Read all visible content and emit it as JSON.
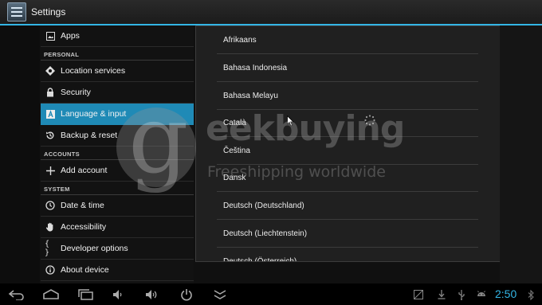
{
  "app": {
    "title": "Settings",
    "accent_color": "#33b5e5",
    "selected_color": "#1f8ab6"
  },
  "sidebar": {
    "items": [
      {
        "type": "item",
        "label": "Apps",
        "icon": "apps-icon"
      },
      {
        "type": "header",
        "label": "PERSONAL"
      },
      {
        "type": "item",
        "label": "Location services",
        "icon": "location-icon"
      },
      {
        "type": "item",
        "label": "Security",
        "icon": "lock-icon"
      },
      {
        "type": "item",
        "label": "Language & input",
        "icon": "language-icon",
        "selected": true
      },
      {
        "type": "item",
        "label": "Backup & reset",
        "icon": "backup-icon"
      },
      {
        "type": "header",
        "label": "ACCOUNTS"
      },
      {
        "type": "item",
        "label": "Add account",
        "icon": "plus-icon"
      },
      {
        "type": "header",
        "label": "SYSTEM"
      },
      {
        "type": "item",
        "label": "Date & time",
        "icon": "clock-icon"
      },
      {
        "type": "item",
        "label": "Accessibility",
        "icon": "hand-icon"
      },
      {
        "type": "item",
        "label": "Developer options",
        "icon": "braces-icon"
      },
      {
        "type": "item",
        "label": "About device",
        "icon": "info-icon"
      }
    ]
  },
  "language_dialog": {
    "options": [
      "Afrikaans",
      "Bahasa Indonesia",
      "Bahasa Melayu",
      "Català",
      "Čeština",
      "Dansk",
      "Deutsch (Deutschland)",
      "Deutsch (Liechtenstein)",
      "Deutsch (Österreich)"
    ]
  },
  "watermark": {
    "brand_letter": "g",
    "brand_rest": "eekbuying",
    "tagline": "Freeshipping worldwide"
  },
  "navbar": {
    "left_icons": [
      "back-icon",
      "home-icon",
      "recent-apps-icon",
      "volume-down-icon",
      "volume-up-icon",
      "power-icon",
      "hide-bar-icon"
    ],
    "status_icons": [
      "screenshot-icon",
      "download-icon",
      "usb-icon",
      "android-debug-icon",
      "bluetooth-icon"
    ],
    "time": "2:50"
  }
}
